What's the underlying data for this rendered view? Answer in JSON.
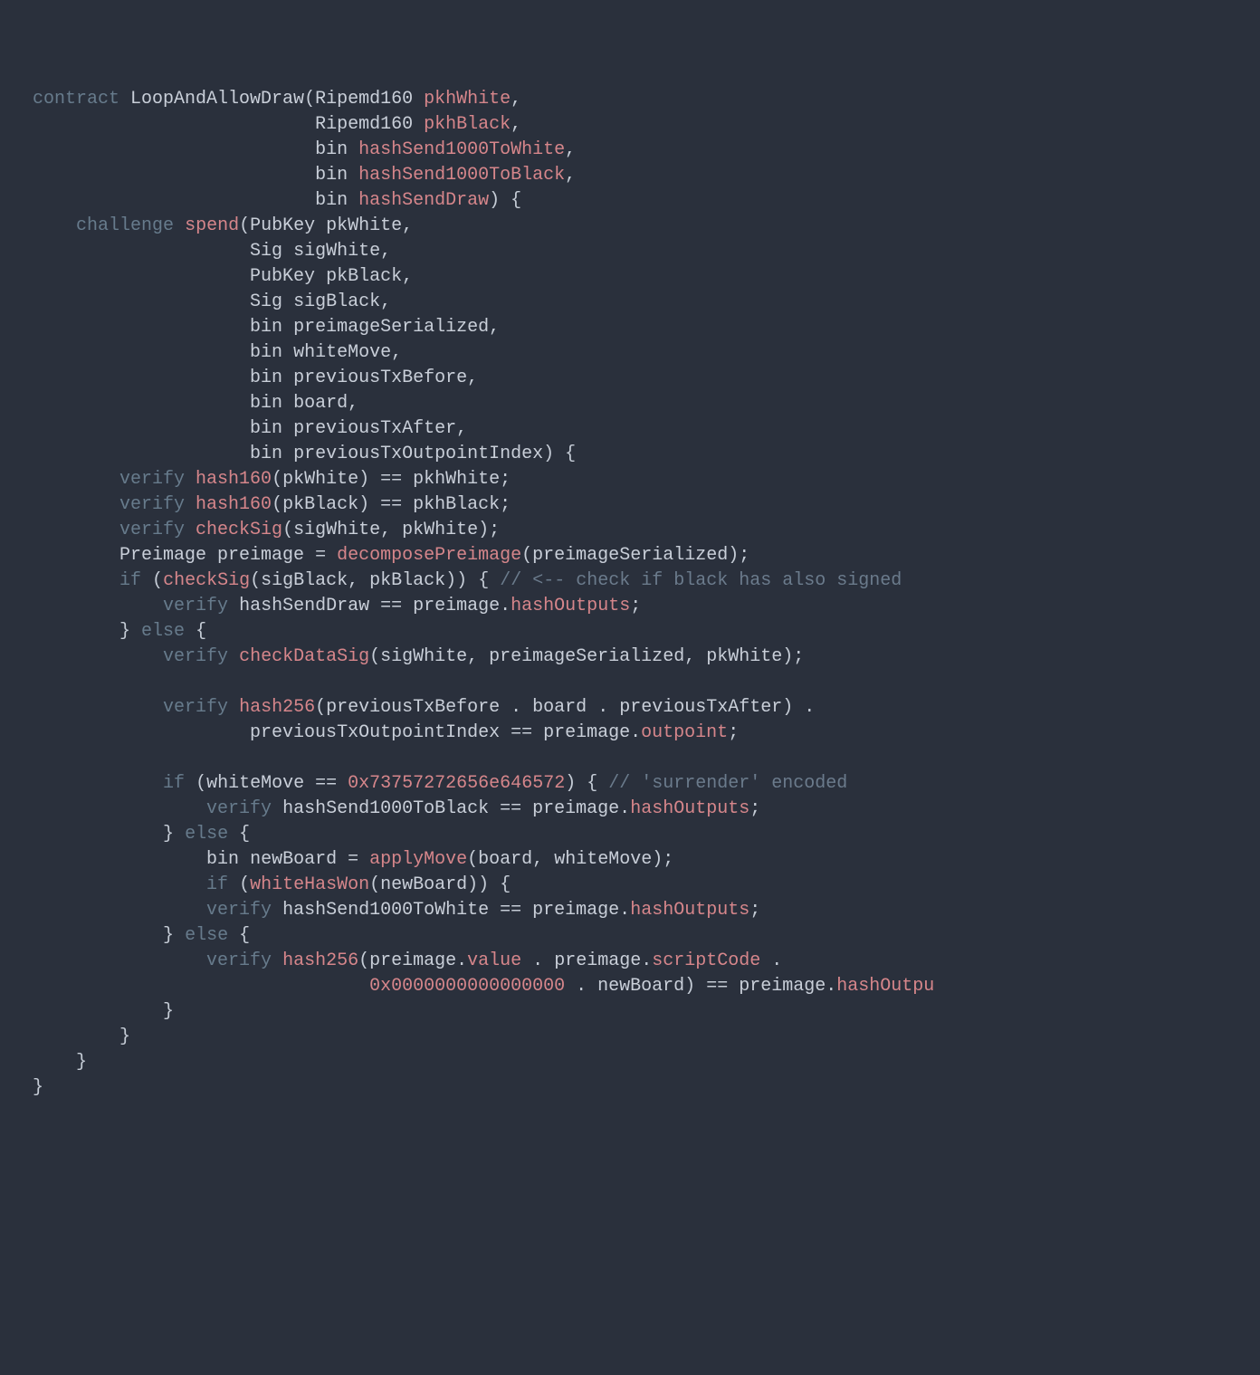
{
  "code": {
    "kw_contract": "contract",
    "contract_name": "LoopAndAllowDraw",
    "t_Ripemd160": "Ripemd160",
    "t_bin": "bin",
    "t_PubKey": "PubKey",
    "t_Sig": "Sig",
    "t_Preimage": "Preimage",
    "p_pkhWhite": "pkhWhite",
    "p_pkhBlack": "pkhBlack",
    "p_hashSend1000ToWhite": "hashSend1000ToWhite",
    "p_hashSend1000ToBlack": "hashSend1000ToBlack",
    "p_hashSendDraw": "hashSendDraw",
    "kw_challenge": "challenge",
    "fn_spend": "spend",
    "a_pkWhite": "pkWhite",
    "a_sigWhite": "sigWhite",
    "a_pkBlack": "pkBlack",
    "a_sigBlack": "sigBlack",
    "a_preimageSerialized": "preimageSerialized",
    "a_whiteMove": "whiteMove",
    "a_previousTxBefore": "previousTxBefore",
    "a_board": "board",
    "a_previousTxAfter": "previousTxAfter",
    "a_previousTxOutpointIndex": "previousTxOutpointIndex",
    "kw_verify": "verify",
    "fn_hash160": "hash160",
    "fn_checkSig": "checkSig",
    "fn_decomposePreimage": "decomposePreimage",
    "fn_checkDataSig": "checkDataSig",
    "fn_hash256": "hash256",
    "fn_applyMove": "applyMove",
    "fn_whiteHasWon": "whiteHasWon",
    "v_preimage": "preimage",
    "v_newBoard": "newBoard",
    "kw_if": "if",
    "kw_else": "else",
    "prop_hashOutputs": "hashOutputs",
    "prop_outpoint": "outpoint",
    "prop_value": "value",
    "prop_scriptCode": "scriptCode",
    "lit_surrender": "0x73757272656e646572",
    "lit_zeros": "0x0000000000000000",
    "cmt_check_black": "// <-- check if black has also signed",
    "cmt_surrender": "// 'surrender' encoded",
    "eq": "==",
    "assign": "=",
    "open_p": "(",
    "close_p": ")",
    "open_b": "{",
    "close_b": "}",
    "comma": ",",
    "semi": ";",
    "dot": ".",
    "sp": " ",
    "prop_hashOutpu": "hashOutpu"
  }
}
